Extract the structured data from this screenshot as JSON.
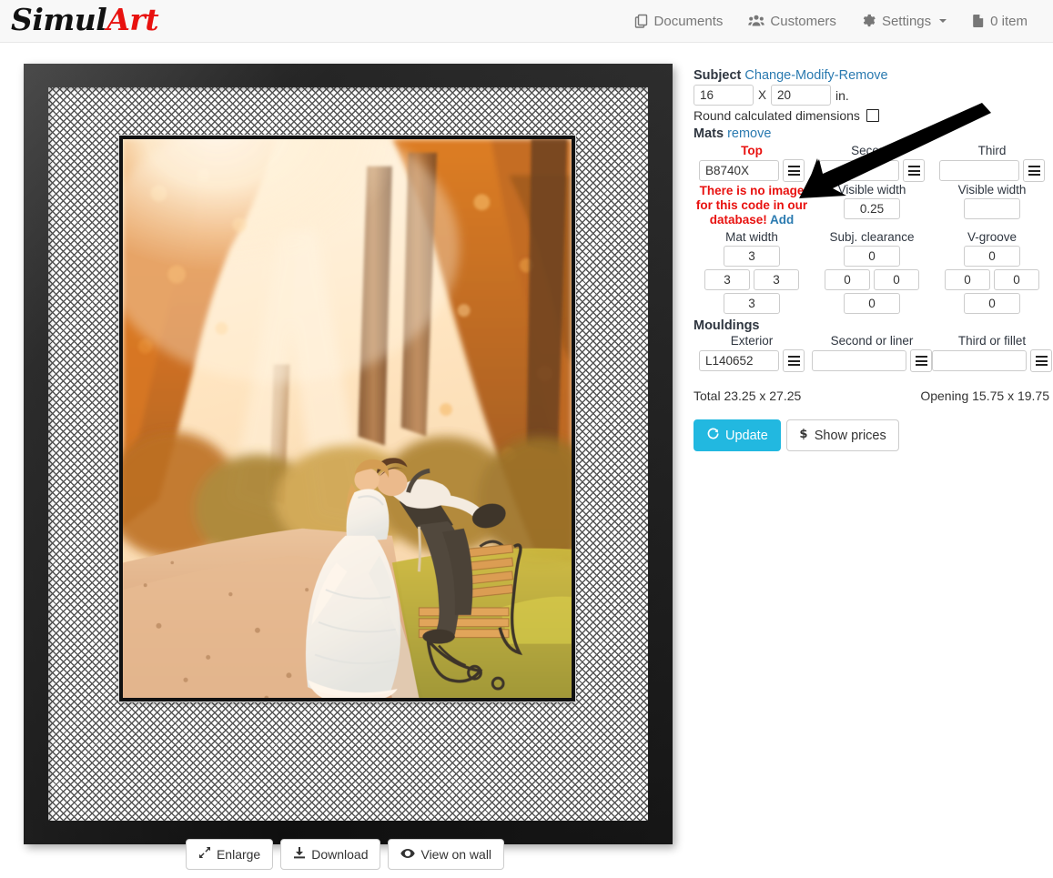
{
  "app": {
    "brand_first": "Simul",
    "brand_second": "Art"
  },
  "nav": {
    "items": [
      {
        "label": "Documents",
        "icon": "documents-icon"
      },
      {
        "label": "Customers",
        "icon": "customers-icon"
      },
      {
        "label": "Settings",
        "icon": "gear-icon",
        "caret": true
      },
      {
        "label": "0 item",
        "icon": "file-icon"
      }
    ]
  },
  "preview": {
    "buttons": [
      {
        "label": "Enlarge",
        "icon": "expand-icon"
      },
      {
        "label": "Download",
        "icon": "download-icon"
      },
      {
        "label": "View on wall",
        "icon": "eye-icon"
      }
    ]
  },
  "subject": {
    "title": "Subject",
    "change_label": "Change",
    "modify_label": "Modify",
    "remove_label": "Remove",
    "sep": "-",
    "width": "16",
    "height": "20",
    "x_label": "X",
    "unit_label": "in.",
    "round_label": "Round calculated dimensions",
    "round_checked": false
  },
  "mats": {
    "title": "Mats",
    "remove_label": "remove",
    "columns": [
      {
        "header": "Top",
        "header_style": "red",
        "code": "B8740X",
        "visible_width_label": "",
        "visible_width": ""
      },
      {
        "header": "Second",
        "header_style": "normal",
        "code": "",
        "visible_width_label": "Visible width",
        "visible_width": "0.25"
      },
      {
        "header": "Third",
        "header_style": "normal",
        "code": "",
        "visible_width_label": "Visible width",
        "visible_width": ""
      }
    ],
    "error": {
      "line1": "There is no image",
      "line2": "for this code in our",
      "line3": "database!",
      "add_label": "Add"
    },
    "widths": {
      "mat_width_label": "Mat width",
      "mat_width": {
        "top": "3",
        "left": "3",
        "right": "3",
        "bottom": "3"
      },
      "clearance_label": "Subj. clearance",
      "clearance": {
        "top": "0",
        "left": "0",
        "right": "0",
        "bottom": "0"
      },
      "vgroove_label": "V-groove",
      "vgroove": {
        "top": "0",
        "left": "0",
        "right": "0",
        "bottom": "0"
      }
    }
  },
  "mouldings": {
    "title": "Mouldings",
    "columns": [
      {
        "header": "Exterior",
        "code": "L140652"
      },
      {
        "header": "Second or liner",
        "code": ""
      },
      {
        "header": "Third or fillet",
        "code": ""
      }
    ]
  },
  "totals": {
    "total": "Total 23.25 x 27.25",
    "opening": "Opening 15.75 x 19.75"
  },
  "actions": {
    "update_label": "Update",
    "show_prices_label": "Show prices"
  },
  "colors": {
    "brand_red": "#e8110f",
    "link_blue": "#2a7ab0",
    "primary": "#22b8e0",
    "navbar_bg": "#f8f8f8"
  }
}
